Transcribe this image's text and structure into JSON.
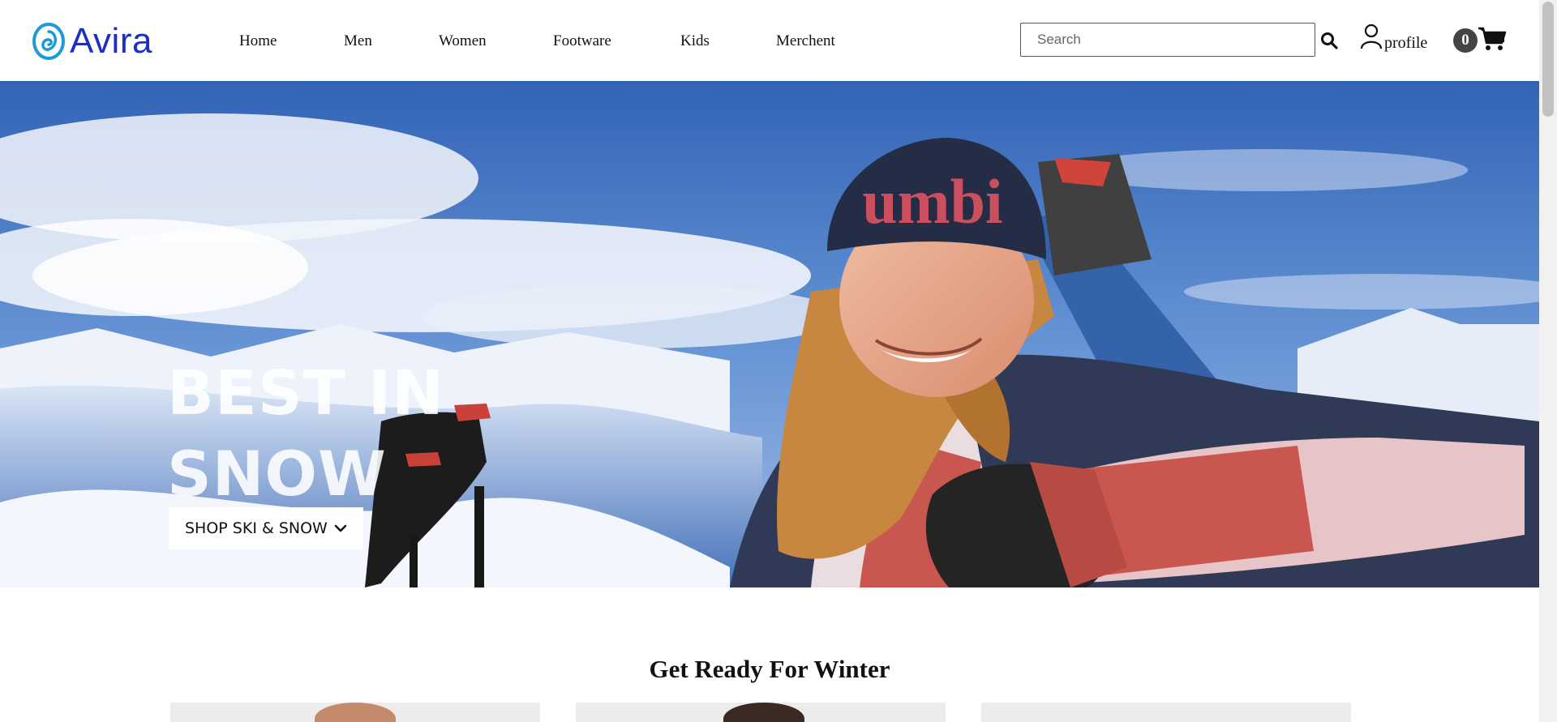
{
  "brand": {
    "name": "Avira",
    "color": "#1b2fc4"
  },
  "nav": {
    "items": [
      {
        "label": "Home"
      },
      {
        "label": "Men"
      },
      {
        "label": "Women"
      },
      {
        "label": "Footware"
      },
      {
        "label": "Kids"
      },
      {
        "label": "Merchent"
      }
    ]
  },
  "search": {
    "placeholder": "Search",
    "value": "",
    "icon": "search-icon"
  },
  "profile": {
    "label": "profile",
    "icon": "user-icon"
  },
  "cart": {
    "count": "0",
    "icon": "cart-icon"
  },
  "hero": {
    "title_line1": "BEST IN",
    "title_line2": "SNOW",
    "button_label": "SHOP SKI & SNOW",
    "button_icon": "chevron-down-icon",
    "hat_text": "umbi"
  },
  "section": {
    "title": "Get Ready For Winter"
  },
  "colors": {
    "sky": "#3a6fc0",
    "snow": "#e9eef8",
    "jacket": "#c9524a",
    "hat": "#1e2740",
    "hair": "#c7843a"
  }
}
